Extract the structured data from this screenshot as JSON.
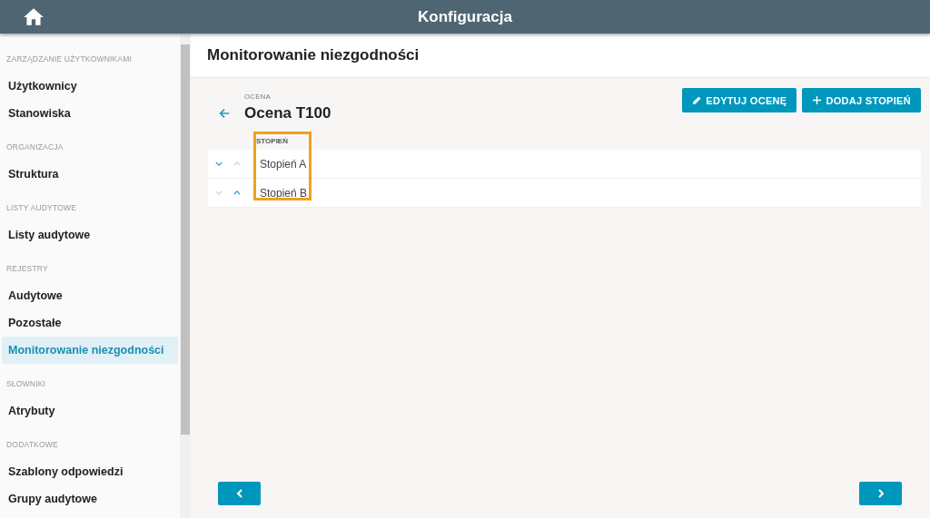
{
  "header": {
    "title": "Konfiguracja"
  },
  "sidebar": {
    "sections": [
      {
        "heading": "ZARZĄDZANIE UŻYTKOWNIKAMI",
        "items": [
          {
            "label": "Użytkownicy",
            "selected": false
          },
          {
            "label": "Stanowiska",
            "selected": false
          }
        ]
      },
      {
        "heading": "ORGANIZACJA",
        "items": [
          {
            "label": "Struktura",
            "selected": false
          }
        ]
      },
      {
        "heading": "LISTY AUDYTOWE",
        "items": [
          {
            "label": "Listy audytowe",
            "selected": false
          }
        ]
      },
      {
        "heading": "REJESTRY",
        "items": [
          {
            "label": "Audytowe",
            "selected": false
          },
          {
            "label": "Pozostałe",
            "selected": false
          },
          {
            "label": "Monitorowanie niezgodności",
            "selected": true
          }
        ]
      },
      {
        "heading": "SŁOWNIKI",
        "items": [
          {
            "label": "Atrybuty",
            "selected": false
          }
        ]
      },
      {
        "heading": "DODATKOWE",
        "items": [
          {
            "label": "Szablony odpowiedzi",
            "selected": false
          },
          {
            "label": "Grupy audytowe",
            "selected": false
          }
        ]
      }
    ]
  },
  "page": {
    "title": "Monitorowanie niezgodności",
    "overline": "OCENA",
    "heading": "Ocena T100",
    "buttons": [
      {
        "label": "EDYTUJ OCENĘ",
        "kind": "edit"
      },
      {
        "label": "DODAJ STOPIEŃ",
        "kind": "add"
      }
    ],
    "table": {
      "column": "STOPIEŃ",
      "rows": [
        {
          "name": "Stopień A",
          "down_enabled": true,
          "up_enabled": false
        },
        {
          "name": "Stopień B",
          "down_enabled": false,
          "up_enabled": true
        }
      ]
    }
  }
}
